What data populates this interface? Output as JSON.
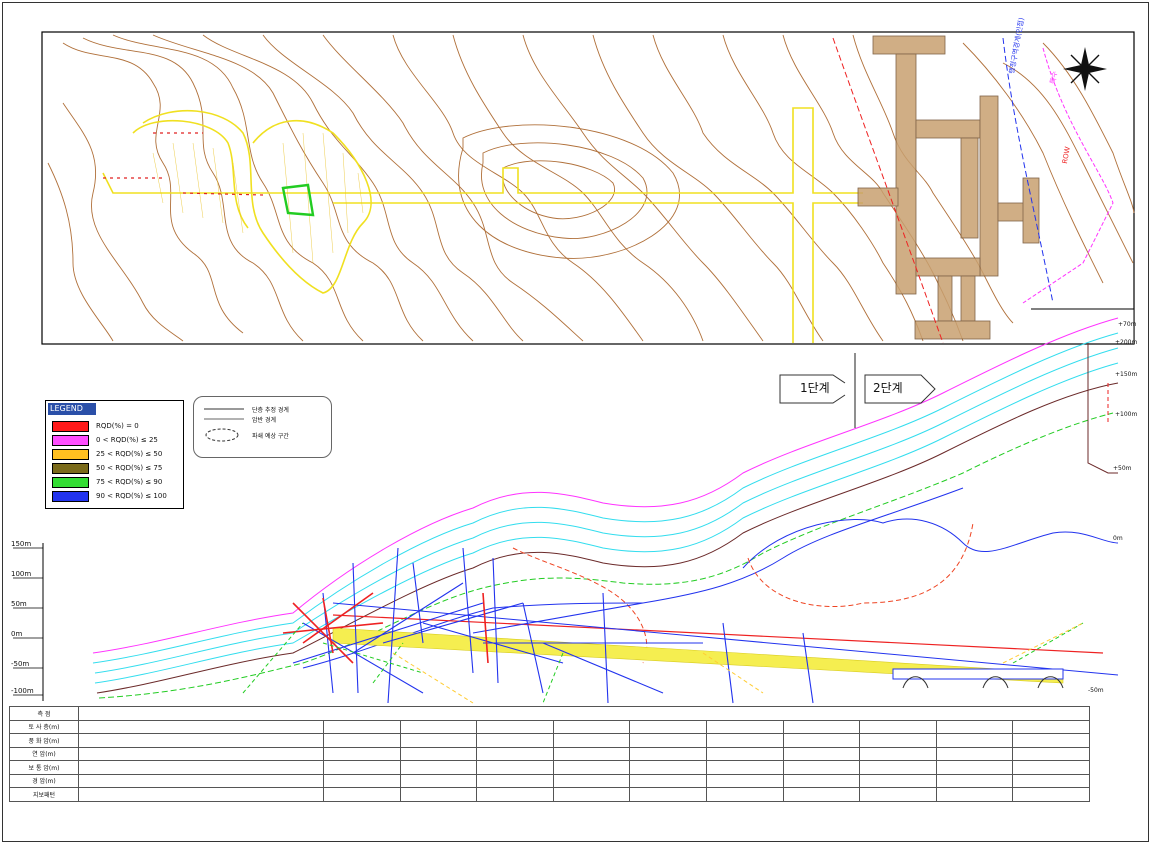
{
  "legend": {
    "title": "LEGEND",
    "items": [
      {
        "label": "RQD(%) = 0",
        "color": "#ff1a1a"
      },
      {
        "label": "0 < RQD(%) ≤ 25",
        "color": "#ff4dff"
      },
      {
        "label": "25 < RQD(%) ≤ 50",
        "color": "#ffc020"
      },
      {
        "label": "50 < RQD(%) ≤ 75",
        "color": "#7a6a1a"
      },
      {
        "label": "75 < RQD(%) ≤ 90",
        "color": "#33dd33"
      },
      {
        "label": "90 < RQD(%) ≤ 100",
        "color": "#2233ee"
      }
    ]
  },
  "line_legend": {
    "items": [
      {
        "label": "단층 추정 경계"
      },
      {
        "label": "암반 경계"
      },
      {
        "label": "파쇄 예상 구간"
      }
    ]
  },
  "stages": {
    "stage1": "1단계",
    "stage2": "2단계"
  },
  "map_labels": {
    "dashed_label": "행정구역경계(인접)",
    "pink_label": "특수",
    "red_label": "ROW"
  },
  "elevation_labels": [
    "150m",
    "100m",
    "50m",
    "0m",
    "-50m",
    "-100m"
  ],
  "right_labels": [
    "+70m",
    "+200m",
    "+150m",
    "+100m",
    "+50m",
    "0m",
    "-50m"
  ],
  "table": {
    "headers": [
      "측 점",
      "토 사 층(m)",
      "풍 화 암(m)",
      "연 암(m)",
      "보 통 암(m)",
      "경 암(m)",
      "지보패턴"
    ],
    "rows": [
      [
        "",
        "",
        "",
        "",
        "",
        "",
        "",
        "",
        "",
        "",
        "",
        ""
      ],
      [
        "",
        "",
        "",
        "",
        "",
        "",
        "",
        "",
        "",
        "",
        "",
        ""
      ],
      [
        "",
        "",
        "",
        "",
        "",
        "",
        "",
        "",
        "",
        "",
        "",
        ""
      ],
      [
        "",
        "",
        "",
        "",
        "",
        "",
        "",
        "",
        "",
        "",
        "",
        ""
      ],
      [
        "",
        "",
        "",
        "",
        "",
        "",
        "",
        "",
        "",
        "",
        "",
        ""
      ],
      [
        "",
        "",
        "",
        "",
        "",
        "",
        "",
        "",
        "",
        "",
        "",
        ""
      ]
    ]
  },
  "colors": {
    "contour": "#b0703a",
    "alignment": "#f0e020",
    "facility": "#c8a070",
    "boundary_blue": "#2233ee",
    "boundary_pink": "#ff33ff",
    "boundary_red": "#ee2222"
  }
}
